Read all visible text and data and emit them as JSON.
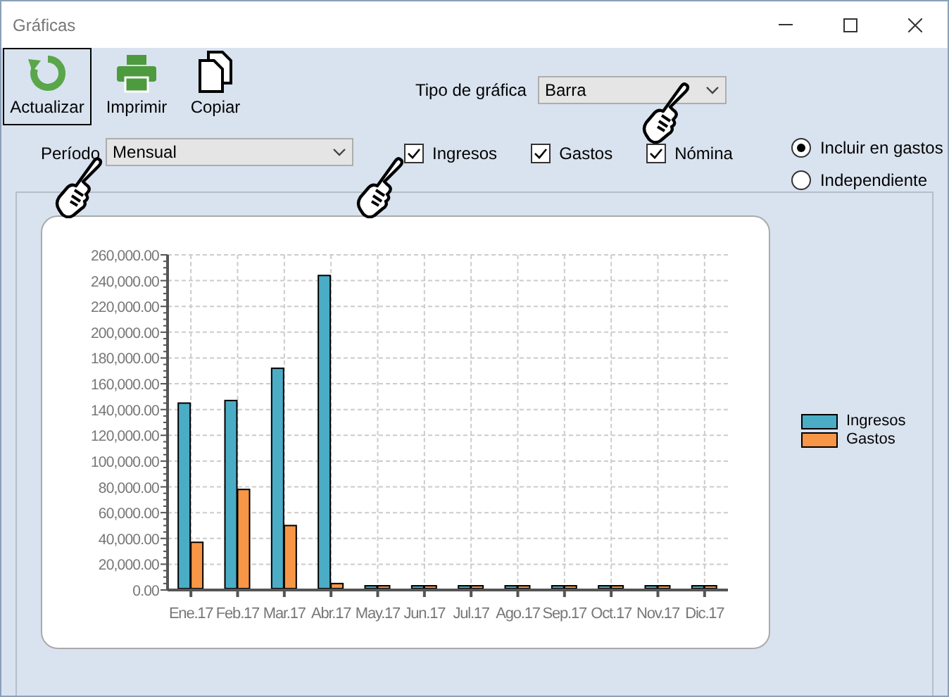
{
  "window": {
    "title": "Gráficas"
  },
  "toolbar": [
    {
      "kind": "refresh",
      "label": "Actualizar",
      "selected": true
    },
    {
      "kind": "print",
      "label": "Imprimir",
      "selected": false
    },
    {
      "kind": "copy",
      "label": "Copiar",
      "selected": false
    }
  ],
  "chart_type": {
    "label": "Tipo de gráfica",
    "value": "Barra"
  },
  "period": {
    "label": "Período",
    "value": "Mensual"
  },
  "checkboxes": [
    {
      "label": "Ingresos",
      "checked": true
    },
    {
      "label": "Gastos",
      "checked": true
    },
    {
      "label": "Nómina",
      "checked": true
    }
  ],
  "radios": [
    {
      "label": "Incluir en gastos",
      "selected": true
    },
    {
      "label": "Independiente",
      "selected": false
    }
  ],
  "chart": {
    "chart_data": {
      "type": "bar",
      "categories": [
        "Ene.17",
        "Feb.17",
        "Mar.17",
        "Abr.17",
        "May.17",
        "Jun.17",
        "Jul.17",
        "Ago.17",
        "Sep.17",
        "Oct.17",
        "Nov.17",
        "Dic.17"
      ],
      "series": [
        {
          "name": "Ingresos",
          "color": "#4bacc6",
          "values": [
            145000,
            147000,
            172000,
            244000,
            0,
            0,
            0,
            0,
            0,
            0,
            0,
            0
          ]
        },
        {
          "name": "Gastos",
          "color": "#f79646",
          "values": [
            37000,
            78000,
            50000,
            5000,
            0,
            0,
            0,
            0,
            0,
            0,
            0,
            0
          ]
        }
      ],
      "ylim": [
        0,
        260000
      ],
      "grid": true,
      "yticks": [
        {
          "value": 0,
          "label": "0.00"
        },
        {
          "value": 20000,
          "label": "20,000.00"
        },
        {
          "value": 40000,
          "label": "40,000.00"
        },
        {
          "value": 60000,
          "label": "60,000.00"
        },
        {
          "value": 80000,
          "label": "80,000.00"
        },
        {
          "value": 100000,
          "label": "100,000.00"
        },
        {
          "value": 120000,
          "label": "120,000.00"
        },
        {
          "value": 140000,
          "label": "140,000.00"
        },
        {
          "value": 160000,
          "label": "160,000.00"
        },
        {
          "value": 180000,
          "label": "180,000.00"
        },
        {
          "value": 200000,
          "label": "200,000.00"
        },
        {
          "value": 220000,
          "label": "220,000.00"
        },
        {
          "value": 240000,
          "label": "240,000.00"
        },
        {
          "value": 260000,
          "label": "260,000.00"
        }
      ]
    }
  }
}
